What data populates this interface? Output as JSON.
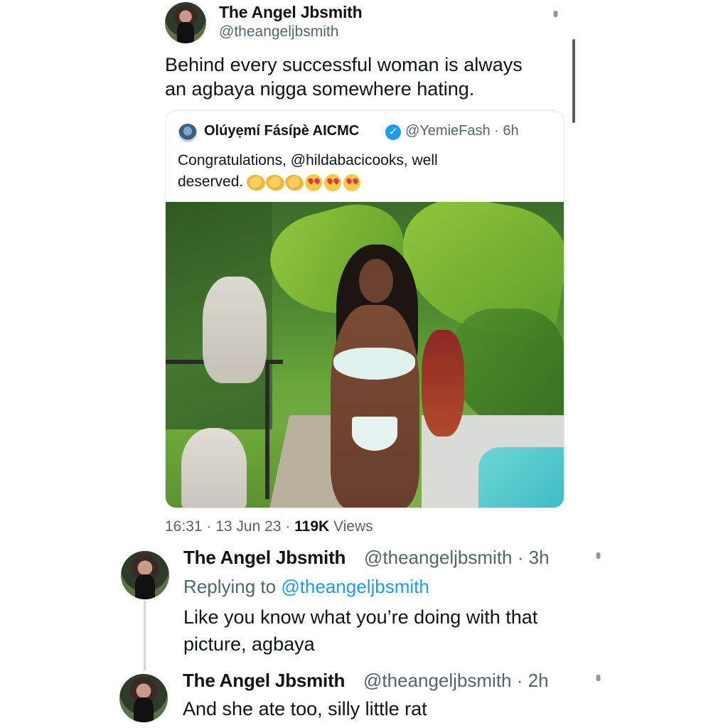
{
  "main_tweet": {
    "author_name": "The Angel Jbsmith",
    "author_handle": "@theangeljbsmith",
    "text_line1": "Behind every successful woman is always",
    "text_line2": "an agbaya nigga somewhere hating.",
    "timestamp": "16:31 · 13 Jun 23 · ",
    "views_count": "119K",
    "views_label": " Views"
  },
  "quoted_tweet": {
    "author_name": "Olúyẹmí Fásípè AICMC",
    "verified_icon": "✓",
    "author_handle": "@YemieFash · 6h",
    "text_line1": "Congratulations, @hildabacicooks, well",
    "text_line2": "deserved. ",
    "emojis": [
      "clap",
      "clap",
      "clap",
      "heart-eyes",
      "heart-eyes",
      "heart-eyes"
    ],
    "accent_color": "#1d9bf0"
  },
  "replies": [
    {
      "author_name": "The Angel Jbsmith",
      "author_handle": "@theangeljbsmith · 3h",
      "replying_prefix": "Replying to ",
      "replying_mention": "@theangeljbsmith",
      "text_line1": "Like you know what you’re doing with that",
      "text_line2": "picture, agbaya"
    },
    {
      "author_name": "The Angel Jbsmith",
      "author_handle": "@theangeljbsmith · 2h",
      "text_line1": "And she ate too, silly little rat"
    }
  ],
  "icons": {
    "more": "more-options-icon",
    "verified": "verified-badge-icon"
  },
  "colors": {
    "link": "#1d9bf0",
    "secondary_text": "#536471",
    "primary_text": "#0f1419"
  }
}
